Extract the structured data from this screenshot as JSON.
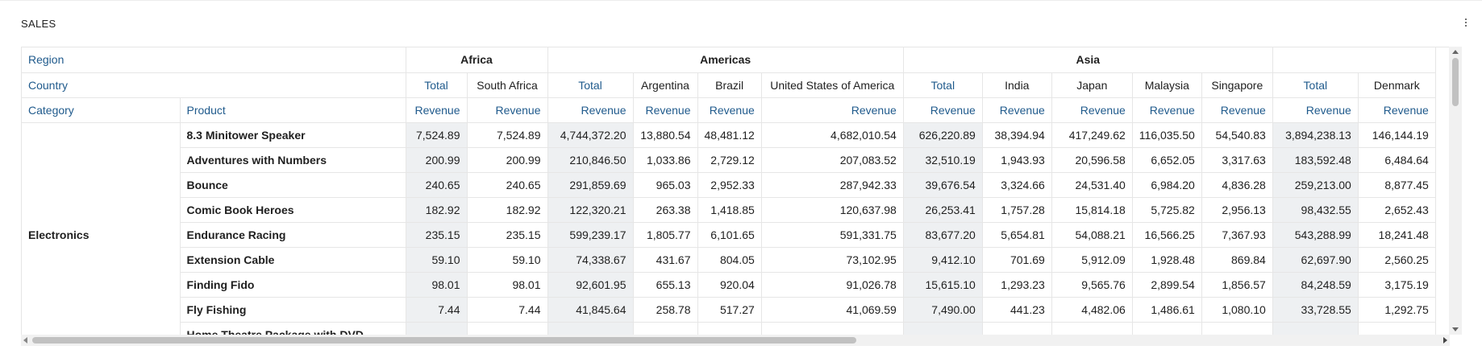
{
  "title": "SALES",
  "menu_icon": "more-vert-icon",
  "header": {
    "region_label": "Region",
    "country_label": "Country",
    "category_label": "Category",
    "product_label": "Product",
    "regions": [
      "Africa",
      "Americas",
      "Asia"
    ],
    "total_label": "Total",
    "revenue_label": "Revenue",
    "countries": {
      "africa": [
        "South Africa"
      ],
      "americas": [
        "Argentina",
        "Brazil",
        "United States of America"
      ],
      "asia": [
        "India",
        "Japan",
        "Malaysia",
        "Singapore"
      ],
      "europe": [
        "Denmark"
      ]
    }
  },
  "category": "Electronics",
  "rows": [
    {
      "product": "8.3 Minitower Speaker",
      "v": [
        "7,524.89",
        "7,524.89",
        "4,744,372.20",
        "13,880.54",
        "48,481.12",
        "4,682,010.54",
        "626,220.89",
        "38,394.94",
        "417,249.62",
        "116,035.50",
        "54,540.83",
        "3,894,238.13",
        "146,144.19"
      ]
    },
    {
      "product": "Adventures with Numbers",
      "v": [
        "200.99",
        "200.99",
        "210,846.50",
        "1,033.86",
        "2,729.12",
        "207,083.52",
        "32,510.19",
        "1,943.93",
        "20,596.58",
        "6,652.05",
        "3,317.63",
        "183,592.48",
        "6,484.64"
      ]
    },
    {
      "product": "Bounce",
      "v": [
        "240.65",
        "240.65",
        "291,859.69",
        "965.03",
        "2,952.33",
        "287,942.33",
        "39,676.54",
        "3,324.66",
        "24,531.40",
        "6,984.20",
        "4,836.28",
        "259,213.00",
        "8,877.45"
      ]
    },
    {
      "product": "Comic Book Heroes",
      "v": [
        "182.92",
        "182.92",
        "122,320.21",
        "263.38",
        "1,418.85",
        "120,637.98",
        "26,253.41",
        "1,757.28",
        "15,814.18",
        "5,725.82",
        "2,956.13",
        "98,432.55",
        "2,652.43"
      ]
    },
    {
      "product": "Endurance Racing",
      "v": [
        "235.15",
        "235.15",
        "599,239.17",
        "1,805.77",
        "6,101.65",
        "591,331.75",
        "83,677.20",
        "5,654.81",
        "54,088.21",
        "16,566.25",
        "7,367.93",
        "543,288.99",
        "18,241.48"
      ]
    },
    {
      "product": "Extension Cable",
      "v": [
        "59.10",
        "59.10",
        "74,338.67",
        "431.67",
        "804.05",
        "73,102.95",
        "9,412.10",
        "701.69",
        "5,912.09",
        "1,928.48",
        "869.84",
        "62,697.90",
        "2,560.25"
      ]
    },
    {
      "product": "Finding Fido",
      "v": [
        "98.01",
        "98.01",
        "92,601.95",
        "655.13",
        "920.04",
        "91,026.78",
        "15,615.10",
        "1,293.23",
        "9,565.76",
        "2,899.54",
        "1,856.57",
        "84,248.59",
        "3,175.19"
      ]
    },
    {
      "product": "Fly Fishing",
      "v": [
        "7.44",
        "7.44",
        "41,845.64",
        "258.78",
        "517.27",
        "41,069.59",
        "7,490.00",
        "441.23",
        "4,482.06",
        "1,486.61",
        "1,080.10",
        "33,728.55",
        "1,292.75"
      ]
    },
    {
      "product": "Home Theatre Package with DVD-",
      "v": [
        "",
        "",
        "",
        "",
        "",
        "",
        "",
        "",
        "",
        "",
        "",
        "",
        ""
      ]
    }
  ]
}
